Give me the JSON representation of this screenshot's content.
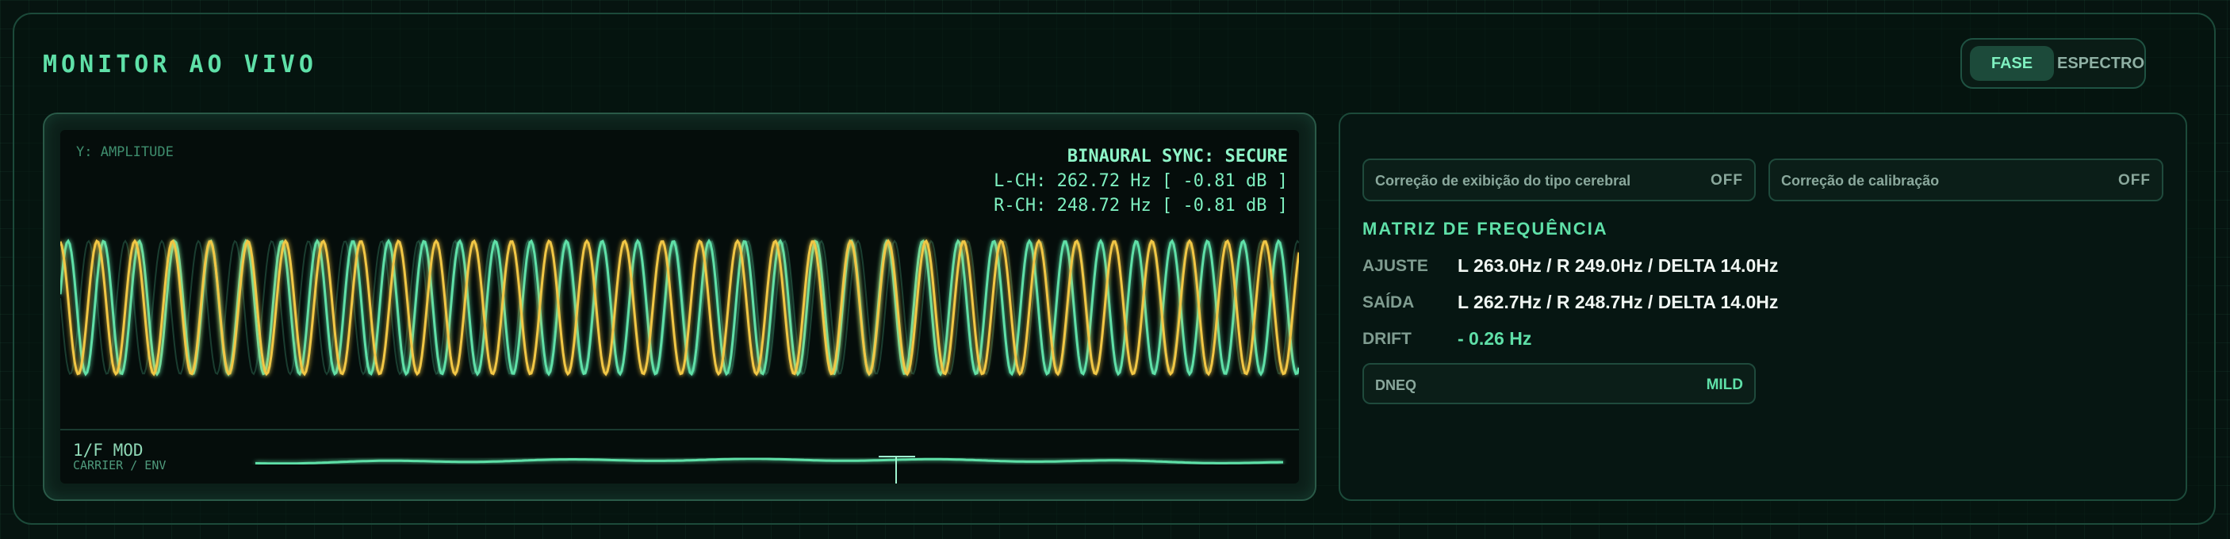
{
  "header": {
    "title": "MONITOR AO VIVO"
  },
  "view_toggle": {
    "active": "FASE",
    "options": [
      "FASE",
      "ESPECTRO"
    ]
  },
  "scope": {
    "y_label": "Y: AMPLITUDE",
    "sync_status": "BINAURAL SYNC: SECURE",
    "left_channel": "L-CH: 262.72 Hz [ -0.81 dB ]",
    "right_channel": "R-CH: 248.72 Hz [ -0.81 dB ]",
    "mod_title": "1/F MOD",
    "mod_subtitle": "CARRIER / ENV"
  },
  "toggles": [
    {
      "label": "Correção de exibição do tipo cerebral",
      "value": "OFF"
    },
    {
      "label": "Correção de calibração",
      "value": "OFF"
    }
  ],
  "matrix": {
    "title": "MATRIZ DE FREQUÊNCIA",
    "rows": [
      {
        "key": "AJUSTE",
        "value": "L 263.0Hz / R 249.0Hz / DELTA 14.0Hz"
      },
      {
        "key": "SAÍDA",
        "value": "L 262.7Hz / R 248.7Hz / DELTA 14.0Hz"
      },
      {
        "key": "DRIFT",
        "value": "- 0.26 Hz"
      }
    ]
  },
  "dneq": {
    "label": "DNEQ",
    "value": "MILD"
  },
  "colors": {
    "accent": "#5fe0a8",
    "left_wave": "#5fe0a8",
    "right_wave": "#f2c744",
    "background": "#061410"
  }
}
